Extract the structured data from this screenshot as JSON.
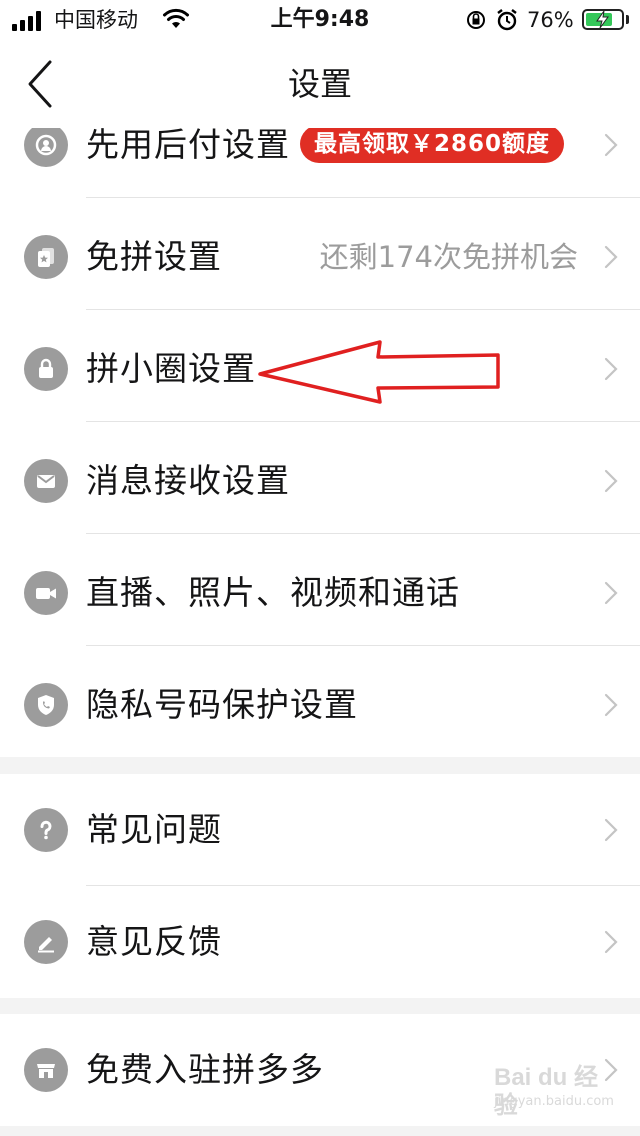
{
  "status_bar": {
    "carrier": "中国移动",
    "time": "上午9:48",
    "battery_percent": "76%",
    "battery_level": 0.76,
    "icons": [
      "signal-icon",
      "wifi-icon",
      "orientation-lock-icon",
      "alarm-icon",
      "battery-charging-icon"
    ]
  },
  "nav": {
    "title": "设置",
    "back_icon": "chevron-left-icon"
  },
  "groups": [
    {
      "rows": [
        {
          "label": "先用后付设置",
          "icon": "wallet-icon",
          "badge": "最高领取￥2860额度",
          "value": ""
        },
        {
          "label": "免拼设置",
          "icon": "cards-icon",
          "badge": "",
          "value": "还剩174次免拼机会"
        },
        {
          "label": "拼小圈设置",
          "icon": "lock-icon",
          "badge": "",
          "value": ""
        },
        {
          "label": "消息接收设置",
          "icon": "mail-icon",
          "badge": "",
          "value": ""
        },
        {
          "label": "直播、照片、视频和通话",
          "icon": "video-camera-icon",
          "badge": "",
          "value": ""
        },
        {
          "label": "隐私号码保护设置",
          "icon": "shield-phone-icon",
          "badge": "",
          "value": ""
        }
      ]
    },
    {
      "rows": [
        {
          "label": "常见问题",
          "icon": "question-icon",
          "badge": "",
          "value": ""
        },
        {
          "label": "意见反馈",
          "icon": "pencil-icon",
          "badge": "",
          "value": ""
        }
      ]
    },
    {
      "rows": [
        {
          "label": "免费入驻拼多多",
          "icon": "store-icon",
          "badge": "",
          "value": ""
        }
      ]
    }
  ],
  "annotation": {
    "type": "arrow",
    "color": "#e02020",
    "points_to": "拼小圈设置"
  },
  "watermark": {
    "logo": "Bai du 经验",
    "url": "jingyan.baidu.com"
  },
  "colors": {
    "accent": "#e02e24",
    "icon_gray": "#9c9c9c",
    "background": "#f3f3f3"
  }
}
